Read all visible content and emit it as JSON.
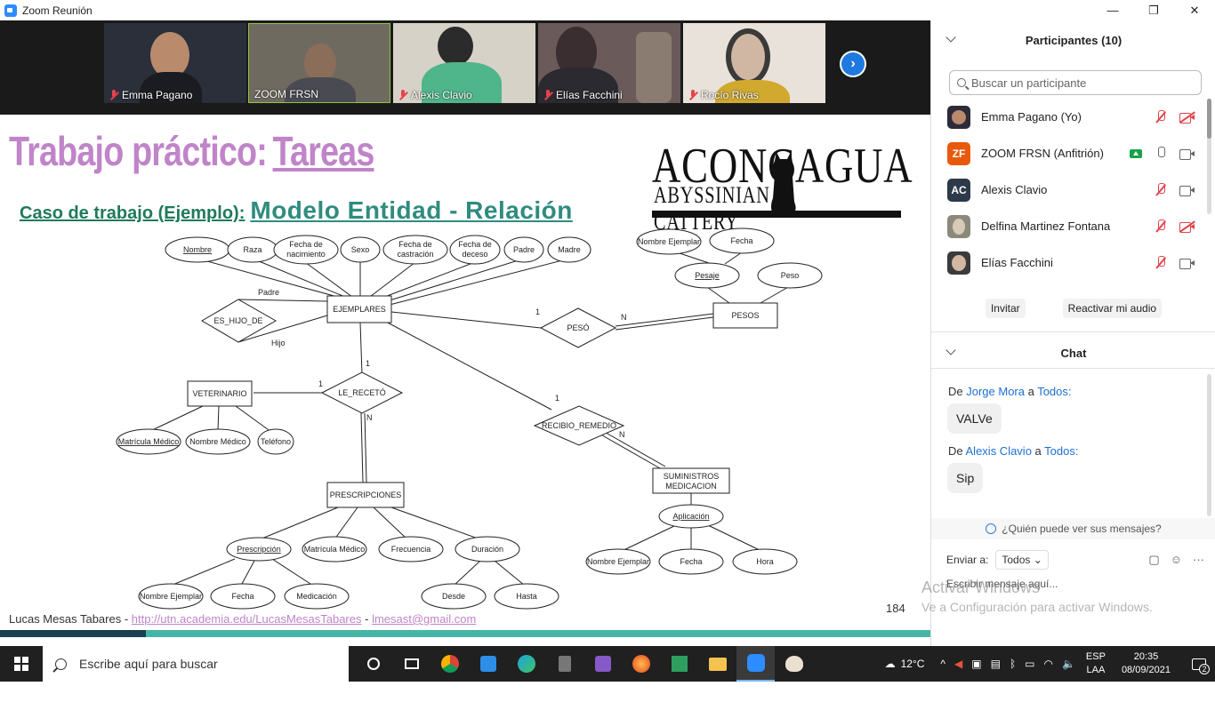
{
  "window": {
    "title": "Zoom Reunión",
    "controls": [
      "—",
      "❐",
      "✕"
    ]
  },
  "video": {
    "tiles": [
      {
        "name": "Emma Pagano",
        "muted": true
      },
      {
        "name": "ZOOM FRSN",
        "muted": false
      },
      {
        "name": "Alexis Clavio",
        "muted": true
      },
      {
        "name": "Elías Facchini",
        "muted": true
      },
      {
        "name": "Rocío Rivas",
        "muted": true
      }
    ]
  },
  "slide": {
    "title_main": "Trabajo práctico:",
    "title_link": "Tareas",
    "subtitle_a": "Caso de trabajo (Ejemplo):",
    "subtitle_b": "Modelo Entidad - Relación",
    "logo_line1": "ACONCAGUA",
    "logo_line2": "ABYSSINIAN CATTERY",
    "footer_author": "Lucas Mesas Tabares - ",
    "footer_url": "http://utn.academia.edu/LucasMesasTabares",
    "footer_sep": " - ",
    "footer_email": "lmesast@gmail.com",
    "page": "184"
  },
  "er": {
    "entities": [
      "EJEMPLARES",
      "PESOS",
      "VETERINARIO",
      "PRESCRIPCIONES",
      "SUMINISTROS",
      "MEDICACION"
    ],
    "relations": [
      "ES_HIJO_DE",
      "PESÓ",
      "LE_RECETÓ",
      "RECIBIO_REMEDIO"
    ],
    "attributes": {
      "nombre": "Nombre",
      "raza": "Raza",
      "fnac1": "Fecha de",
      "fnac2": "nacimiento",
      "sexo": "Sexo",
      "fcas1": "Fecha de",
      "fcas2": "castración",
      "fdec1": "Fecha de",
      "fdec2": "deceso",
      "padre": "Padre",
      "madre": "Madre",
      "nombre_ejemplar": "Nombre Ejemplar",
      "fecha": "Fecha",
      "pesaje": "Pesaje",
      "peso": "Peso",
      "matricula": "Matrícula Médico",
      "nombre_medico": "Nombre Médico",
      "telefono": "Teléfono",
      "prescripcion": "Prescripción",
      "frecuencia": "Frecuencia",
      "duracion": "Duración",
      "medicacion": "Medicación",
      "desde": "Desde",
      "hasta": "Hasta",
      "aplicacion": "Aplicación",
      "hora": "Hora"
    },
    "roles": {
      "padre": "Padre",
      "hijo": "Hijo"
    },
    "card": {
      "one": "1",
      "n": "N"
    }
  },
  "panel": {
    "participants_title": "Participantes (10)",
    "search_placeholder": "Buscar un participante",
    "participants": [
      {
        "name": "Emma Pagano (Yo)",
        "initials": "",
        "color": "#2b2b3a",
        "mic": "off",
        "cam": "off"
      },
      {
        "name": "ZOOM FRSN (Anfitrión)",
        "initials": "ZF",
        "color": "#e8590c",
        "mic": "on",
        "cam": "on",
        "sharing": true
      },
      {
        "name": "Alexis Clavio",
        "initials": "AC",
        "color": "#2d3a4a",
        "mic": "off",
        "cam": "on"
      },
      {
        "name": "Delfina Martinez Fontana",
        "initials": "",
        "color": "#8a8a7a",
        "mic": "off",
        "cam": "off"
      },
      {
        "name": "Elías Facchini",
        "initials": "",
        "color": "#3b3b3b",
        "mic": "off",
        "cam": "on"
      }
    ],
    "invite": "Invitar",
    "unmute": "Reactivar mi audio",
    "chat_title": "Chat",
    "messages": [
      {
        "prefix": "De ",
        "user": "Jorge Mora",
        "mid": " a ",
        "to": "Todos:",
        "text": "VALVe"
      },
      {
        "prefix": "De ",
        "user": "Alexis Clavio",
        "mid": " a ",
        "to": "Todos:",
        "text": "Sip"
      }
    ],
    "who_can_see": "¿Quién puede ver sus mensajes?",
    "send_to_label": "Enviar a:",
    "send_to_value": "Todos",
    "message_placeholder": "Escribir mensaje aquí..."
  },
  "watermark": {
    "line1": "Activar Windows",
    "line2": "Ve a Configuración para activar Windows."
  },
  "taskbar": {
    "search_placeholder": "Escribe aquí para buscar",
    "weather": "12°C",
    "lang1": "ESP",
    "lang2": "LAA",
    "time": "20:35",
    "date": "08/09/2021",
    "notifications": "2"
  }
}
